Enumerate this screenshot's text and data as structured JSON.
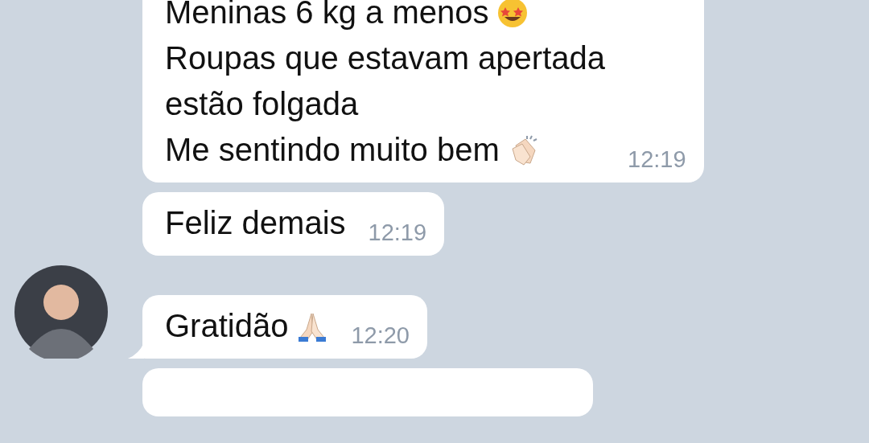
{
  "messages": [
    {
      "lines": [
        {
          "text": "Meninas 6 kg a menos",
          "kind": "starry"
        },
        {
          "text": "Roupas que estavam apertada",
          "kind": "plain"
        },
        {
          "text": "estão folgada",
          "kind": "plain"
        },
        {
          "text": "Me sentindo muito bem",
          "kind": "clap"
        }
      ],
      "time": "12:19",
      "tail": false,
      "avatar": false
    },
    {
      "lines": [
        {
          "text": "Feliz demais",
          "kind": "plain"
        }
      ],
      "time": "12:19",
      "tail": false,
      "avatar": false
    },
    {
      "lines": [
        {
          "text": "Gratidão",
          "kind": "pray"
        }
      ],
      "time": "12:20",
      "tail": true,
      "avatar": true
    },
    {
      "tail": false,
      "avatar": false
    }
  ]
}
